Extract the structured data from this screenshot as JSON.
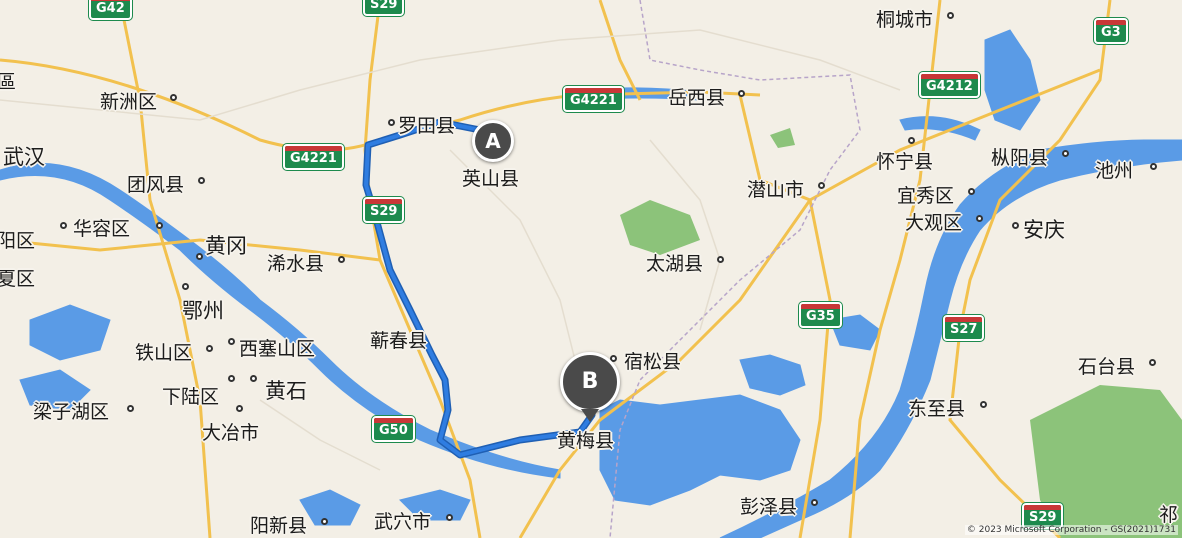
{
  "map": {
    "copyright": "© 2023 Microsoft Corporation - GS(2021)1731",
    "route": {
      "color": "#2f7de1",
      "start_label": "A",
      "end_label": "B"
    },
    "colors": {
      "water": "#5a9be6",
      "land": "#f3efe6",
      "park": "#8cc37a",
      "highway": "#f2c14e",
      "route": "#2f7de1"
    },
    "places": [
      {
        "name": "桐城市"
      },
      {
        "name": "新洲区"
      },
      {
        "name": "罗田县"
      },
      {
        "name": "岳西县"
      },
      {
        "name": "英山县"
      },
      {
        "name": "怀宁县"
      },
      {
        "name": "枞阳县"
      },
      {
        "name": "池州"
      },
      {
        "name": "武汉"
      },
      {
        "name": "团风县"
      },
      {
        "name": "潜山市"
      },
      {
        "name": "宜秀区"
      },
      {
        "name": "大观区"
      },
      {
        "name": "安庆"
      },
      {
        "name": "华容区"
      },
      {
        "name": "黄冈"
      },
      {
        "name": "浠水县"
      },
      {
        "name": "太湖县"
      },
      {
        "name": "鄂州"
      },
      {
        "name": "蕲春县"
      },
      {
        "name": "铁山区"
      },
      {
        "name": "西塞山区"
      },
      {
        "name": "宿松县"
      },
      {
        "name": "石台县"
      },
      {
        "name": "黄石"
      },
      {
        "name": "下陆区"
      },
      {
        "name": "梁子湖区"
      },
      {
        "name": "东至县"
      },
      {
        "name": "大冶市"
      },
      {
        "name": "黄梅县"
      },
      {
        "name": "彭泽县"
      },
      {
        "name": "阳新县"
      },
      {
        "name": "武穴市"
      },
      {
        "name": "祁"
      },
      {
        "name": "阳区"
      },
      {
        "name": "夏区"
      },
      {
        "name": "區"
      }
    ],
    "shields": [
      "G42",
      "S29",
      "G4221",
      "G4212",
      "G3",
      "G4221",
      "S29",
      "G35",
      "S27",
      "G50",
      "S29"
    ]
  }
}
